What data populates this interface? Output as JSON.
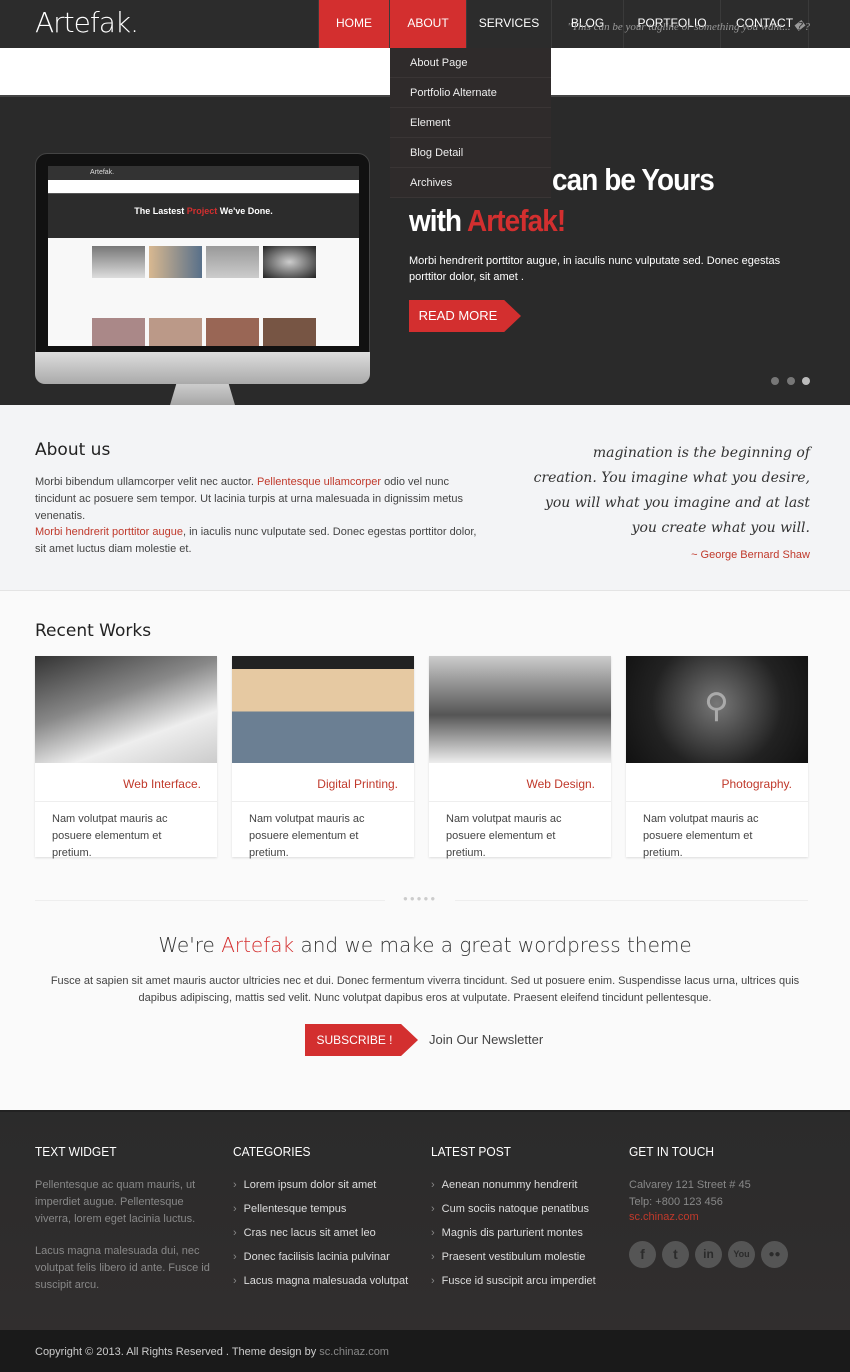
{
  "header": {
    "logo": "Artefak.",
    "nav": [
      "HOME",
      "ABOUT",
      "SERVICES",
      "BLOG",
      "PORTFOLIO",
      "CONTACT"
    ],
    "active": "HOME",
    "hover": "ABOUT",
    "accent": "#d32f2f"
  },
  "tagline": "\"This can be your tagline or something you want... �?",
  "dropdown": [
    "About Page",
    "Portfolio Alternate",
    "Element",
    "Blog Detail",
    "Archives"
  ],
  "hero": {
    "line1": "can be Yours",
    "line2a": "with ",
    "line2b": "Artefak!",
    "text": "Morbi hendrerit porttitor augue, in iaculis nunc vulputate sed. Donec egestas porttitor dolor, sit amet .",
    "button": "READ MORE",
    "screen_logo": "Artefak.",
    "screen_title_a": "The Lastest ",
    "screen_title_b": "Project",
    "screen_title_c": " We've Done."
  },
  "about": {
    "title": "About us",
    "p1a": "Morbi bibendum ullamcorper velit nec auctor. ",
    "p1link": "Pellentesque ullamcorper",
    "p1b": " odio vel nunc tincidunt ac posuere sem tempor. Ut lacinia turpis at urna malesuada in dignissim metus venenatis.",
    "p2link": "Morbi hendrerit porttitor augue",
    "p2b": ", in iaculis nunc vulputate sed. Donec egestas porttitor dolor, sit amet luctus diam molestie et.",
    "quote": "magination is the beginning of creation. You imagine what you desire, you will what you imagine and at last you create what you will.",
    "author": "~ George Bernard Shaw"
  },
  "works": {
    "title": "Recent Works",
    "items": [
      {
        "title": "Web Interface.",
        "text": "Nam volutpat mauris ac posuere elementum et pretium."
      },
      {
        "title": "Digital Printing.",
        "text": "Nam volutpat mauris ac posuere elementum et pretium."
      },
      {
        "title": "Web Design.",
        "text": "Nam volutpat mauris ac posuere elementum et pretium."
      },
      {
        "title": "Photography.",
        "text": "Nam volutpat mauris ac posuere elementum et pretium."
      }
    ]
  },
  "promo": {
    "h_a": "We're ",
    "h_b": "Artefak",
    "h_c": " and we make a great wordpress theme",
    "text": "Fusce at sapien sit amet mauris auctor ultricies nec et dui. Donec fermentum viverra tincidunt. Sed ut posuere enim. Suspendisse lacus urna, ultrices quis dapibus adipiscing, mattis sed velit. Nunc volutpat dapibus eros at vulputate. Praesent eleifend tincidunt pellentesque.",
    "button": "SUBSCRIBE !",
    "newsletter": "Join Our Newsletter"
  },
  "footer": {
    "text_widget": {
      "title": "TEXT WIDGET",
      "p1": "Pellentesque ac quam mauris, ut imperdiet augue. Pellentesque viverra, lorem eget lacinia luctus.",
      "p2": "Lacus magna malesuada dui, nec volutpat felis libero id ante. Fusce id suscipit arcu."
    },
    "categories": {
      "title": "CATEGORIES",
      "items": [
        "Lorem ipsum dolor sit amet",
        "Pellentesque tempus",
        "Cras nec lacus sit amet leo",
        "Donec facilisis lacinia pulvinar",
        "Lacus magna malesuada volutpat"
      ]
    },
    "latest": {
      "title": "LATEST POST",
      "items": [
        "Aenean nonummy hendrerit",
        "Cum sociis natoque penatibus",
        "Magnis dis parturient montes",
        "Praesent vestibulum molestie",
        "Fusce id suscipit arcu imperdiet"
      ]
    },
    "contact": {
      "title": "GET IN TOUCH",
      "address": "Calvarey 121 Street # 45",
      "phone": "Telp: +800 123 456",
      "site": "sc.chinaz.com",
      "social": [
        "f",
        "t",
        "in",
        "yt",
        "fl"
      ]
    }
  },
  "copyright": {
    "text": "Copyright © 2013. All Rights Reserved . Theme design by ",
    "link": "sc.chinaz.com"
  }
}
